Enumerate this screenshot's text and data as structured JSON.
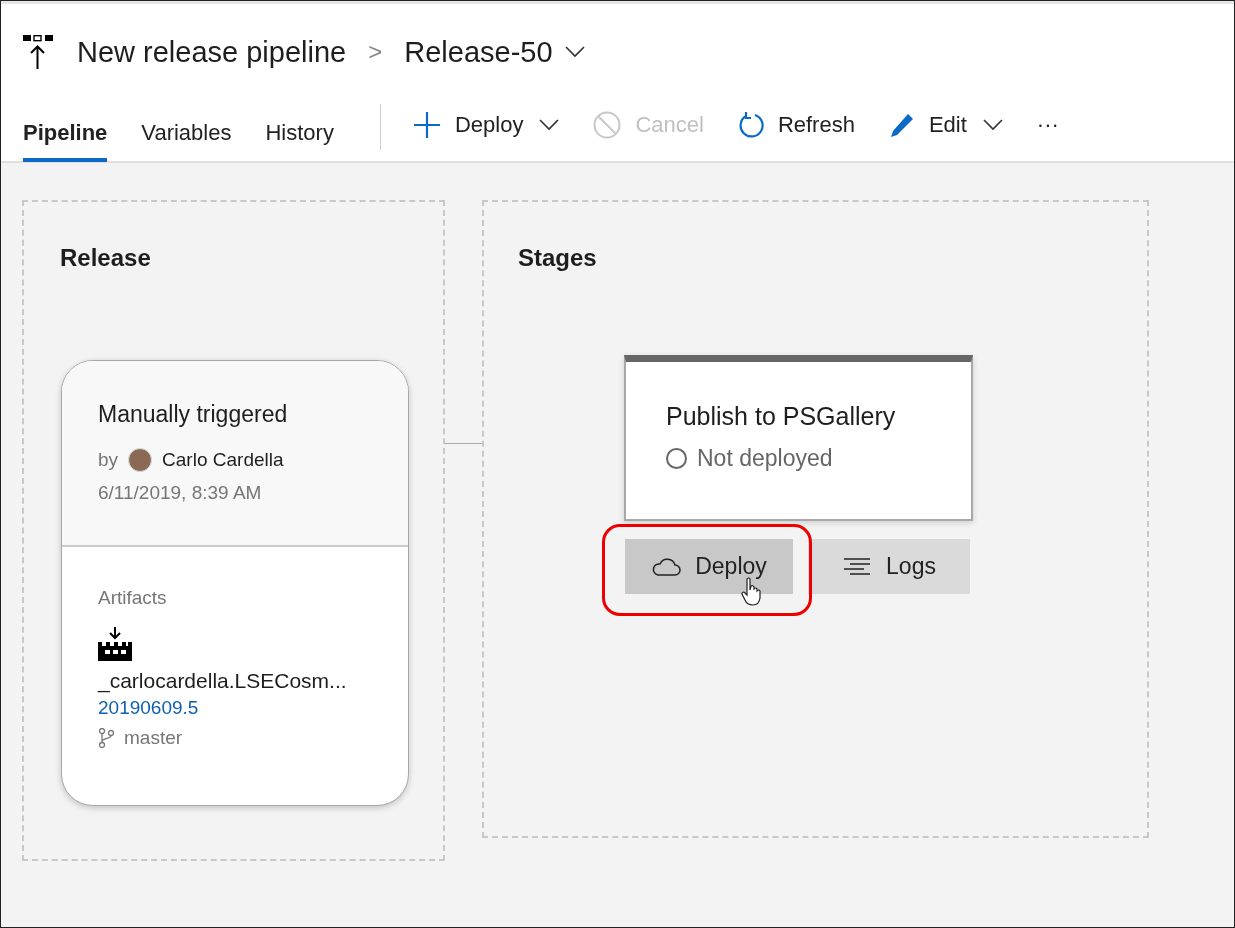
{
  "header": {
    "pipeline": "New release pipeline",
    "separator": ">",
    "release": "Release-50"
  },
  "tabs": [
    {
      "label": "Pipeline",
      "selected": true
    },
    {
      "label": "Variables",
      "selected": false
    },
    {
      "label": "History",
      "selected": false
    }
  ],
  "toolbar": [
    {
      "kind": "deploy",
      "label": "Deploy",
      "disabled": false,
      "dropdown": true
    },
    {
      "kind": "cancel",
      "label": "Cancel",
      "disabled": true,
      "dropdown": false
    },
    {
      "kind": "refresh",
      "label": "Refresh",
      "disabled": false,
      "dropdown": false
    },
    {
      "kind": "edit",
      "label": "Edit",
      "disabled": false,
      "dropdown": true
    },
    {
      "kind": "more",
      "label": "···",
      "disabled": false,
      "dropdown": false
    }
  ],
  "release_panel": {
    "title": "Release",
    "trigger": "Manually triggered",
    "by": "by",
    "user": "Carlo Cardella",
    "date": "6/11/2019, 8:39 AM",
    "artifacts_label": "Artifacts",
    "artifact": "_carlocardella.LSECosm...",
    "build": "20190609.5",
    "branch": "master"
  },
  "stages_panel": {
    "title": "Stages",
    "stage": "Publish to PSGallery",
    "status": "Not deployed",
    "actions": [
      {
        "kind": "deploy",
        "label": "Deploy",
        "hovered": true,
        "highlighted": true
      },
      {
        "kind": "logs",
        "label": "Logs",
        "hovered": false,
        "highlighted": false
      }
    ]
  }
}
